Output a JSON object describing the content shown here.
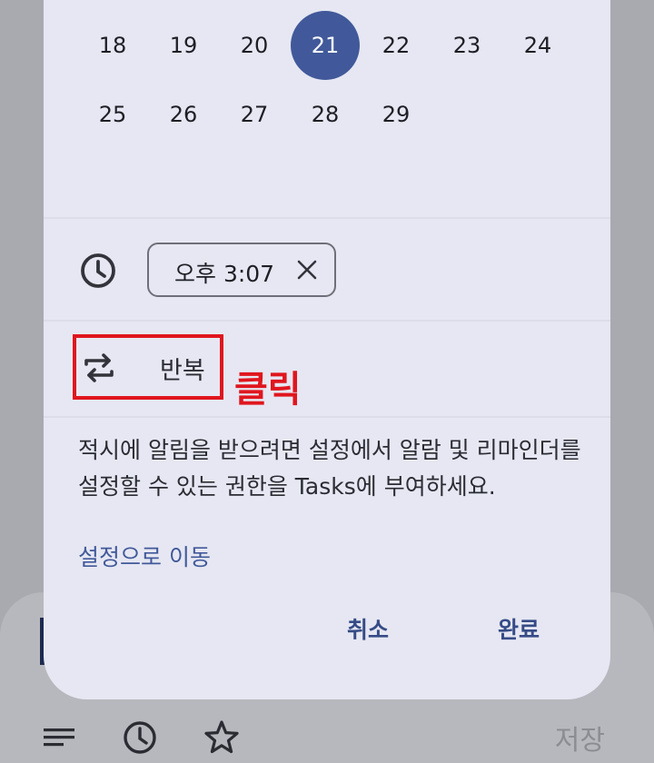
{
  "calendar": {
    "rows": [
      [
        "18",
        "19",
        "20",
        "21",
        "22",
        "23",
        "24"
      ],
      [
        "25",
        "26",
        "27",
        "28",
        "29"
      ]
    ],
    "selected_day": "21",
    "selected_color": "#41599a"
  },
  "time": {
    "icon": "clock-icon",
    "value": "오후 3:07",
    "clear_icon": "close-icon"
  },
  "repeat": {
    "icon": "repeat-icon",
    "label": "반복"
  },
  "annotation": {
    "text": "클릭",
    "color": "#e0161e"
  },
  "permission": {
    "message": "적시에 알림을 받으려면 설정에서 알람 및 리마인더를 설정할 수 있는 권한을 Tasks에 부여하세요.",
    "link": "설정으로 이동"
  },
  "actions": {
    "cancel": "취소",
    "done": "완료"
  },
  "bottom_bar": {
    "icons": [
      "details-icon",
      "clock-icon",
      "star-icon"
    ],
    "save_label": "저장"
  }
}
